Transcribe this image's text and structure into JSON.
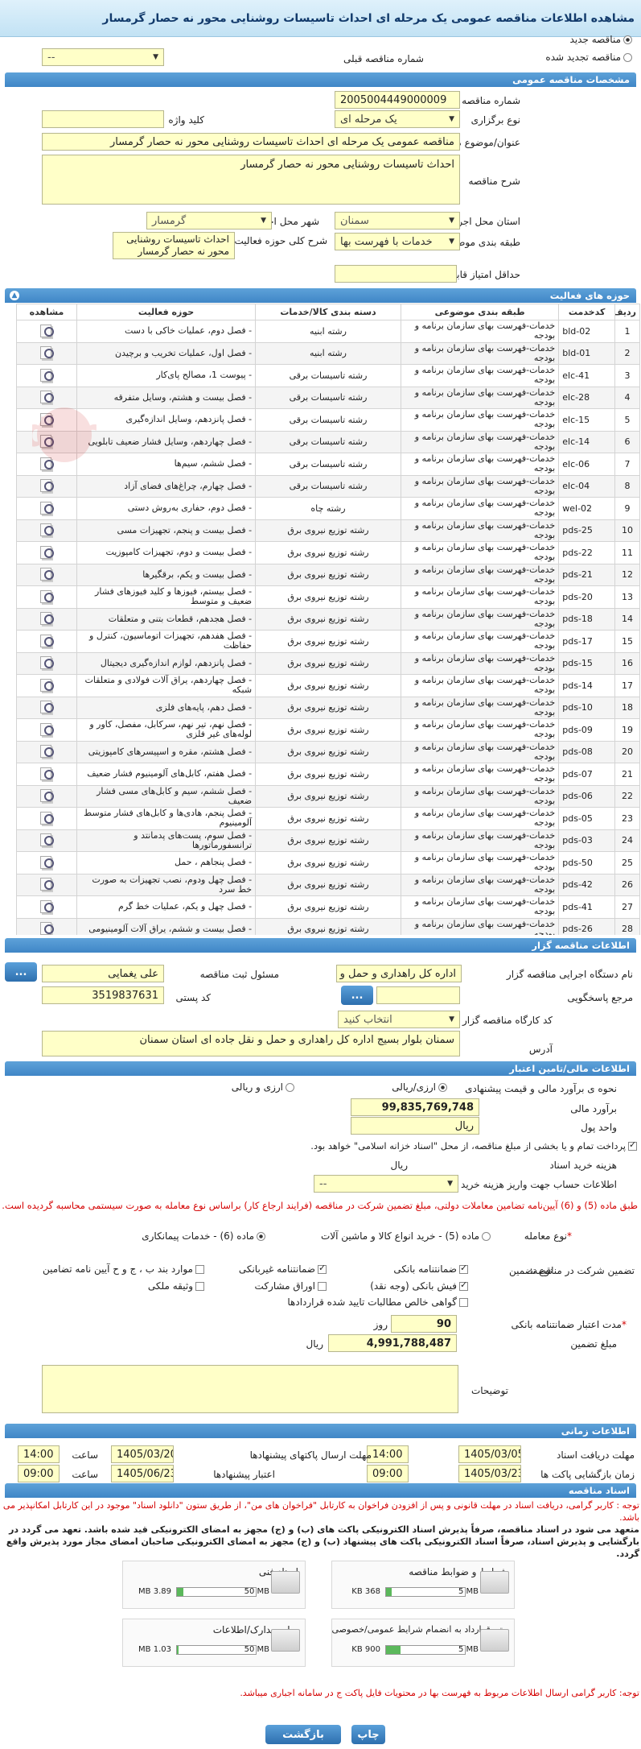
{
  "page": {
    "title": "مشاهده اطلاعات مناقصه عمومی یک مرحله ای احداث تاسیسات روشنایی محور نه حصار گرمسار"
  },
  "top": {
    "new_label": "مناقصه جدید",
    "renew_label": "مناقصه تجدید شده",
    "prev_label": "شماره مناقصه قبلی",
    "prev_value": "--"
  },
  "general": {
    "header": "مشخصات مناقصه عمومی",
    "number_label": "شماره مناقصه",
    "number_value": "2005004449000009",
    "type_label": "نوع برگزاری",
    "type_value": "یک مرحله ای",
    "keyword_label": "کلید واژه",
    "keyword_value": "",
    "subject_label": "عنوان/موضوع مناقصه",
    "subject_value": "مناقصه عمومی یک مرحله ای احداث تاسیسات روشنایی محور نه حصار گرمسار",
    "desc_label": "شرح مناقصه",
    "desc_value": "احداث تاسیسات روشنایی محور نه حصار گرمسار",
    "province_label": "استان محل اجرا",
    "province_value": "سمنان",
    "city_label": "شهر محل اجرا",
    "city_value": "گرمسار",
    "category_label": "طبقه بندی موضوعی",
    "category_value": "خدمات با فهرست بها",
    "activity_label": "شرح کلی حوزه فعالیت",
    "activity_value": "احداث تاسیسات روشنایی محور نه حصار گرمسار",
    "min_score_label": "حداقل امتیاز قابل قبول ارزیابی فنی/بازرگانی",
    "min_score_value": ""
  },
  "activities": {
    "header": "حوزه های فعالیت",
    "columns": [
      "ردیف",
      "کدخدمت",
      "طبقه بندی موضوعی",
      "دسته بندی کالا/خدمات",
      "حوزه فعالیت",
      "مشاهده"
    ],
    "rows": [
      [
        "1",
        "bld-02",
        "خدمات-فهرست بهای سازمان برنامه و بودجه",
        "رشته ابنیه",
        "- فصل دوم، عملیات خاکی با دست"
      ],
      [
        "2",
        "bld-01",
        "خدمات-فهرست بهای سازمان برنامه و بودجه",
        "رشته ابنیه",
        "- فصل اول، عملیات تخریب و برچیدن"
      ],
      [
        "3",
        "elc-41",
        "خدمات-فهرست بهای سازمان برنامه و بودجه",
        "رشته تاسیسات برقی",
        "- پیوست 1، مصالح پای‌کار"
      ],
      [
        "4",
        "elc-28",
        "خدمات-فهرست بهای سازمان برنامه و بودجه",
        "رشته تاسیسات برقی",
        "- فصل بیست و هشتم، وسایل متفرقه"
      ],
      [
        "5",
        "elc-15",
        "خدمات-فهرست بهای سازمان برنامه و بودجه",
        "رشته تاسیسات برقی",
        "- فصل پانزدهم، وسایل اندازه‌گیری"
      ],
      [
        "6",
        "elc-14",
        "خدمات-فهرست بهای سازمان برنامه و بودجه",
        "رشته تاسیسات برقی",
        "- فصل چهاردهم، وسایل فشار ضعیف تابلویی"
      ],
      [
        "7",
        "elc-06",
        "خدمات-فهرست بهای سازمان برنامه و بودجه",
        "رشته تاسیسات برقی",
        "- فصل ششم، سیم‌ها"
      ],
      [
        "8",
        "elc-04",
        "خدمات-فهرست بهای سازمان برنامه و بودجه",
        "رشته تاسیسات برقی",
        "- فصل چهارم، چراغ‌های فضای آزاد"
      ],
      [
        "9",
        "wel-02",
        "خدمات-فهرست بهای سازمان برنامه و بودجه",
        "رشته چاه",
        "- فصل دوم، حفاری به‌روش دستی"
      ],
      [
        "10",
        "pds-25",
        "خدمات-فهرست بهای سازمان برنامه و بودجه",
        "رشته توزیع نیروی برق",
        "- فصل بیست و پنجم، تجهیزات مسی"
      ],
      [
        "11",
        "pds-22",
        "خدمات-فهرست بهای سازمان برنامه و بودجه",
        "رشته توزیع نیروی برق",
        "- فصل بیست و دوم، تجهیزات کامپوزیت"
      ],
      [
        "12",
        "pds-21",
        "خدمات-فهرست بهای سازمان برنامه و بودجه",
        "رشته توزیع نیروی برق",
        "- فصل بیست و یکم، برقگیرها"
      ],
      [
        "13",
        "pds-20",
        "خدمات-فهرست بهای سازمان برنامه و بودجه",
        "رشته توزیع نیروی برق",
        "- فصل بیستم، فیوزها و کلید فیوزهای فشار ضعیف و متوسط"
      ],
      [
        "14",
        "pds-18",
        "خدمات-فهرست بهای سازمان برنامه و بودجه",
        "رشته توزیع نیروی برق",
        "- فصل هجدهم، قطعات بتنی و متعلقات"
      ],
      [
        "15",
        "pds-17",
        "خدمات-فهرست بهای سازمان برنامه و بودجه",
        "رشته توزیع نیروی برق",
        "- فصل هفدهم، تجهیزات اتوماسیون، کنترل و حفاظت"
      ],
      [
        "16",
        "pds-15",
        "خدمات-فهرست بهای سازمان برنامه و بودجه",
        "رشته توزیع نیروی برق",
        "- فصل پانزدهم، لوازم اندازه‌گیری دیجیتال"
      ],
      [
        "17",
        "pds-14",
        "خدمات-فهرست بهای سازمان برنامه و بودجه",
        "رشته توزیع نیروی برق",
        "- فصل چهاردهم، یراق آلات فولادی و متعلقات شبکه"
      ],
      [
        "18",
        "pds-10",
        "خدمات-فهرست بهای سازمان برنامه و بودجه",
        "رشته توزیع نیروی برق",
        "- فصل دهم، پایه‌های فلزی"
      ],
      [
        "19",
        "pds-09",
        "خدمات-فهرست بهای سازمان برنامه و بودجه",
        "رشته توزیع نیروی برق",
        "- فصل نهم، تیر نهم، سرکابل، مفصل، کاور و لوله‌های غیر فلزی"
      ],
      [
        "20",
        "pds-08",
        "خدمات-فهرست بهای سازمان برنامه و بودجه",
        "رشته توزیع نیروی برق",
        "- فصل هشتم، مقره و اسپیسرهای کامپوزیتی"
      ],
      [
        "21",
        "pds-07",
        "خدمات-فهرست بهای سازمان برنامه و بودجه",
        "رشته توزیع نیروی برق",
        "- فصل هفتم، کابل‌های آلومینیوم فشار ضعیف"
      ],
      [
        "22",
        "pds-06",
        "خدمات-فهرست بهای سازمان برنامه و بودجه",
        "رشته توزیع نیروی برق",
        "- فصل ششم، سیم و کابل‌های مسی فشار ضعیف"
      ],
      [
        "23",
        "pds-05",
        "خدمات-فهرست بهای سازمان برنامه و بودجه",
        "رشته توزیع نیروی برق",
        "- فصل پنجم، هادی‌ها و کابل‌های فشار متوسط آلومینیوم"
      ],
      [
        "24",
        "pds-03",
        "خدمات-فهرست بهای سازمان برنامه و بودجه",
        "رشته توزیع نیروی برق",
        "- فصل سوم، پست‌های پدمانتد و ترانسفورماتورها"
      ],
      [
        "25",
        "pds-50",
        "خدمات-فهرست بهای سازمان برنامه و بودجه",
        "رشته توزیع نیروی برق",
        "- فصل پنجاهم ، حمل"
      ],
      [
        "26",
        "pds-42",
        "خدمات-فهرست بهای سازمان برنامه و بودجه",
        "رشته توزیع نیروی برق",
        "- فصل چهل ودوم، نصب تجهیزات به صورت خط سرد"
      ],
      [
        "27",
        "pds-41",
        "خدمات-فهرست بهای سازمان برنامه و بودجه",
        "رشته توزیع نیروی برق",
        "- فصل چهل و یکم، عملیات خط گرم"
      ],
      [
        "28",
        "pds-26",
        "خدمات-فهرست بهای سازمان برنامه و بودجه",
        "رشته توزیع نیروی برق",
        "- فصل بیست و ششم، یراق آلات آلومینیومی"
      ]
    ]
  },
  "tenderer": {
    "header": "اطلاعات مناقصه گزار",
    "org_label": "نام دستگاه اجرایی مناقصه گزار",
    "org_value": "اداره کل راهداری و حمل و نقل",
    "resp_label": "مسئول ثبت مناقصه",
    "resp_value": "علی  یغمایی",
    "ref_label": "مرجع پاسخگویی",
    "ref_value": "",
    "postal_label": "کد پستی",
    "postal_value": "3519837631",
    "workshop_label": "کد کارگاه مناقصه گزار",
    "workshop_value": "انتخاب کنید",
    "address_label": "آدرس",
    "address_value": "سمنان بلوار بسیج اداره کل راهداری و حمل و نقل جاده ای استان سمنان",
    "more_btn": "..."
  },
  "financial": {
    "header": "اطلاعات مالی/تامین اعتبار",
    "method_label": "نحوه ی برآورد مالی و قیمت پیشنهادی",
    "opt_currency": "ارزی/ریالی",
    "opt_rial": "ارزی و ریالی",
    "estimate_label": "برآورد مالی",
    "estimate_value": "99,835,769,748",
    "unit_label": "واحد پول",
    "unit_value": "ریال",
    "installment_text": "پرداخت تمام و یا بخشی از مبلغ مناقصه، از محل \"اسناد خزانه اسلامی\" خواهد بود.",
    "doc_cost_label": "هزینه خرید اسناد",
    "doc_cost_unit": "ریال",
    "account_label": "اطلاعات حساب جهت واریز هزینه خرید اسناد",
    "account_value": "--",
    "notice": "طبق ماده (5) و (6) آیین‌نامه تضامین معاملات دولتی، مبلغ تضمین شرکت در مناقصه (فرایند ارجاع کار) براساس نوع معامله به صورت سیستمی محاسبه گردیده است.",
    "deal_label": "نوع معامله",
    "deal_opt5": "ماده (5) - خرید انواع کالا و ماشین آلات",
    "deal_opt6": "ماده (6) - خدمات پیمانکاری",
    "guarantee_label": "تضمین شرکت در مناقصه:",
    "guarantee_type_label": "نوع تضمین",
    "g_bank": "ضمانتنامه بانکی",
    "g_nonbank": "ضمانتنامه غیربانکی",
    "g_clause": "موارد بند ب ، ج و ح آیین نامه تضامین",
    "g_cash": "فیش بانکی (وجه نقد)",
    "g_bonds": "اوراق مشارکت",
    "g_property": "وثیقه ملکی",
    "g_claims": "گواهی خالص مطالبات تایید شده قراردادها",
    "validity_label": "مدت اعتبار ضمانتنامه بانکی",
    "validity_value": "90",
    "validity_unit": "روز",
    "amount_label": "مبلغ تضمین",
    "amount_value": "4,991,788,487",
    "amount_unit": "ریال",
    "notes_label": "توضیحات",
    "notes_value": ""
  },
  "timing": {
    "header": "اطلاعات زمانی",
    "recv_label": "مهلت دریافت اسناد",
    "recv_date": "1405/03/05",
    "recv_time": "14:00",
    "send_label": "مهلت ارسال پاکتهای پیشنهادها",
    "send_date": "1405/03/20",
    "send_time": "14:00",
    "open_label": "زمان بازگشایی پاکت ها",
    "open_date": "1405/03/23",
    "open_time": "09:00",
    "valid_label": "اعتبار پیشنهادها",
    "valid_date": "1405/06/23",
    "valid_time": "09:00",
    "time_label": "ساعت"
  },
  "docs": {
    "header": "اسناد مناقصه",
    "note1": "توجه : کاربر گرامی، دریافت اسناد در مهلت قانونی و پس از افزودن فراخوان به کارتابل \"فراخوان های من\"، از طریق ستون \"دانلود اسناد\" موجود در این کارتابل امکانپذیر می باشد.",
    "note2": "متعهد می شود در اسناد مناقصه، صرفاً پذیرش اسناد الکترونیکی پاکت های (ب) و (ج) مجهز به امضای الکترونیکی قید شده باشد. تعهد می گردد در بارگشایی و پذیرش اسناد، صرفاً اسناد الکترونیکی پاکت های پیشنهاد (ب) و (ج) مجهز به امضای الکترونیکی صاحبان امضای مجاز مورد پذیرش واقع گردد.",
    "files": [
      {
        "name": "شرایط و ضوابط مناقصه",
        "size": "368 KB",
        "max": "5 MB",
        "fill": 0.07
      },
      {
        "name": "اسناد فنی",
        "size": "3.89 MB",
        "max": "50 MB",
        "fill": 0.08
      },
      {
        "name": "متن قرارداد به انضمام شرایط عمومی/خصوصی",
        "size": "900 KB",
        "max": "5 MB",
        "fill": 0.18
      },
      {
        "name": "سایر مدارک/اطلاعات",
        "size": "1.03 MB",
        "max": "50 MB",
        "fill": 0.02
      }
    ],
    "note3": "توجه: کاربر گرامی ارسال اطلاعات مربوط به فهرست بها در محتویات فایل پاکت ج در سامانه اجباری میباشد."
  },
  "buttons": {
    "print": "چاپ",
    "back": "بازگشت"
  },
  "colors": {
    "section": "#3f86c6",
    "input": "#ffffc8",
    "notice": "#d40000"
  }
}
